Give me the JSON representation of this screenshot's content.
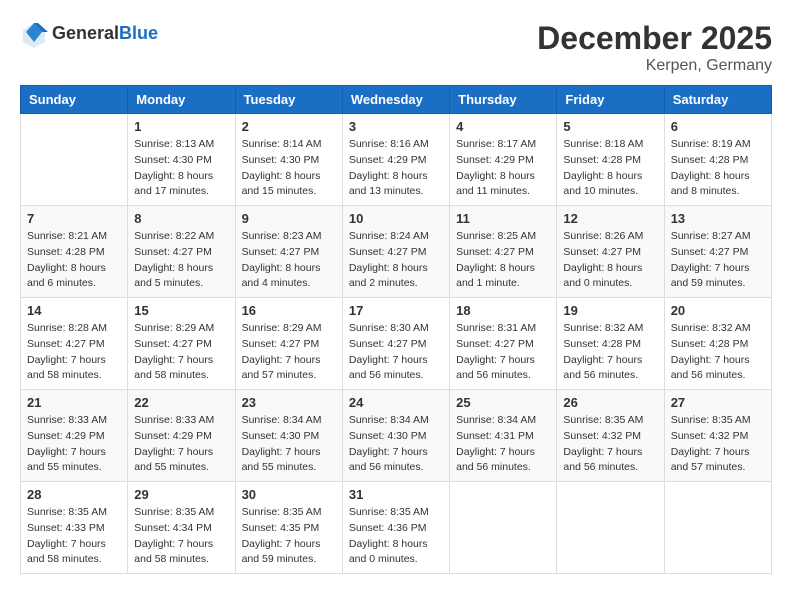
{
  "header": {
    "logo_general": "General",
    "logo_blue": "Blue",
    "month": "December 2025",
    "location": "Kerpen, Germany"
  },
  "weekdays": [
    "Sunday",
    "Monday",
    "Tuesday",
    "Wednesday",
    "Thursday",
    "Friday",
    "Saturday"
  ],
  "weeks": [
    [
      {
        "day": "",
        "info": ""
      },
      {
        "day": "1",
        "info": "Sunrise: 8:13 AM\nSunset: 4:30 PM\nDaylight: 8 hours\nand 17 minutes."
      },
      {
        "day": "2",
        "info": "Sunrise: 8:14 AM\nSunset: 4:30 PM\nDaylight: 8 hours\nand 15 minutes."
      },
      {
        "day": "3",
        "info": "Sunrise: 8:16 AM\nSunset: 4:29 PM\nDaylight: 8 hours\nand 13 minutes."
      },
      {
        "day": "4",
        "info": "Sunrise: 8:17 AM\nSunset: 4:29 PM\nDaylight: 8 hours\nand 11 minutes."
      },
      {
        "day": "5",
        "info": "Sunrise: 8:18 AM\nSunset: 4:28 PM\nDaylight: 8 hours\nand 10 minutes."
      },
      {
        "day": "6",
        "info": "Sunrise: 8:19 AM\nSunset: 4:28 PM\nDaylight: 8 hours\nand 8 minutes."
      }
    ],
    [
      {
        "day": "7",
        "info": "Sunrise: 8:21 AM\nSunset: 4:28 PM\nDaylight: 8 hours\nand 6 minutes."
      },
      {
        "day": "8",
        "info": "Sunrise: 8:22 AM\nSunset: 4:27 PM\nDaylight: 8 hours\nand 5 minutes."
      },
      {
        "day": "9",
        "info": "Sunrise: 8:23 AM\nSunset: 4:27 PM\nDaylight: 8 hours\nand 4 minutes."
      },
      {
        "day": "10",
        "info": "Sunrise: 8:24 AM\nSunset: 4:27 PM\nDaylight: 8 hours\nand 2 minutes."
      },
      {
        "day": "11",
        "info": "Sunrise: 8:25 AM\nSunset: 4:27 PM\nDaylight: 8 hours\nand 1 minute."
      },
      {
        "day": "12",
        "info": "Sunrise: 8:26 AM\nSunset: 4:27 PM\nDaylight: 8 hours\nand 0 minutes."
      },
      {
        "day": "13",
        "info": "Sunrise: 8:27 AM\nSunset: 4:27 PM\nDaylight: 7 hours\nand 59 minutes."
      }
    ],
    [
      {
        "day": "14",
        "info": "Sunrise: 8:28 AM\nSunset: 4:27 PM\nDaylight: 7 hours\nand 58 minutes."
      },
      {
        "day": "15",
        "info": "Sunrise: 8:29 AM\nSunset: 4:27 PM\nDaylight: 7 hours\nand 58 minutes."
      },
      {
        "day": "16",
        "info": "Sunrise: 8:29 AM\nSunset: 4:27 PM\nDaylight: 7 hours\nand 57 minutes."
      },
      {
        "day": "17",
        "info": "Sunrise: 8:30 AM\nSunset: 4:27 PM\nDaylight: 7 hours\nand 56 minutes."
      },
      {
        "day": "18",
        "info": "Sunrise: 8:31 AM\nSunset: 4:27 PM\nDaylight: 7 hours\nand 56 minutes."
      },
      {
        "day": "19",
        "info": "Sunrise: 8:32 AM\nSunset: 4:28 PM\nDaylight: 7 hours\nand 56 minutes."
      },
      {
        "day": "20",
        "info": "Sunrise: 8:32 AM\nSunset: 4:28 PM\nDaylight: 7 hours\nand 56 minutes."
      }
    ],
    [
      {
        "day": "21",
        "info": "Sunrise: 8:33 AM\nSunset: 4:29 PM\nDaylight: 7 hours\nand 55 minutes."
      },
      {
        "day": "22",
        "info": "Sunrise: 8:33 AM\nSunset: 4:29 PM\nDaylight: 7 hours\nand 55 minutes."
      },
      {
        "day": "23",
        "info": "Sunrise: 8:34 AM\nSunset: 4:30 PM\nDaylight: 7 hours\nand 55 minutes."
      },
      {
        "day": "24",
        "info": "Sunrise: 8:34 AM\nSunset: 4:30 PM\nDaylight: 7 hours\nand 56 minutes."
      },
      {
        "day": "25",
        "info": "Sunrise: 8:34 AM\nSunset: 4:31 PM\nDaylight: 7 hours\nand 56 minutes."
      },
      {
        "day": "26",
        "info": "Sunrise: 8:35 AM\nSunset: 4:32 PM\nDaylight: 7 hours\nand 56 minutes."
      },
      {
        "day": "27",
        "info": "Sunrise: 8:35 AM\nSunset: 4:32 PM\nDaylight: 7 hours\nand 57 minutes."
      }
    ],
    [
      {
        "day": "28",
        "info": "Sunrise: 8:35 AM\nSunset: 4:33 PM\nDaylight: 7 hours\nand 58 minutes."
      },
      {
        "day": "29",
        "info": "Sunrise: 8:35 AM\nSunset: 4:34 PM\nDaylight: 7 hours\nand 58 minutes."
      },
      {
        "day": "30",
        "info": "Sunrise: 8:35 AM\nSunset: 4:35 PM\nDaylight: 7 hours\nand 59 minutes."
      },
      {
        "day": "31",
        "info": "Sunrise: 8:35 AM\nSunset: 4:36 PM\nDaylight: 8 hours\nand 0 minutes."
      },
      {
        "day": "",
        "info": ""
      },
      {
        "day": "",
        "info": ""
      },
      {
        "day": "",
        "info": ""
      }
    ]
  ]
}
